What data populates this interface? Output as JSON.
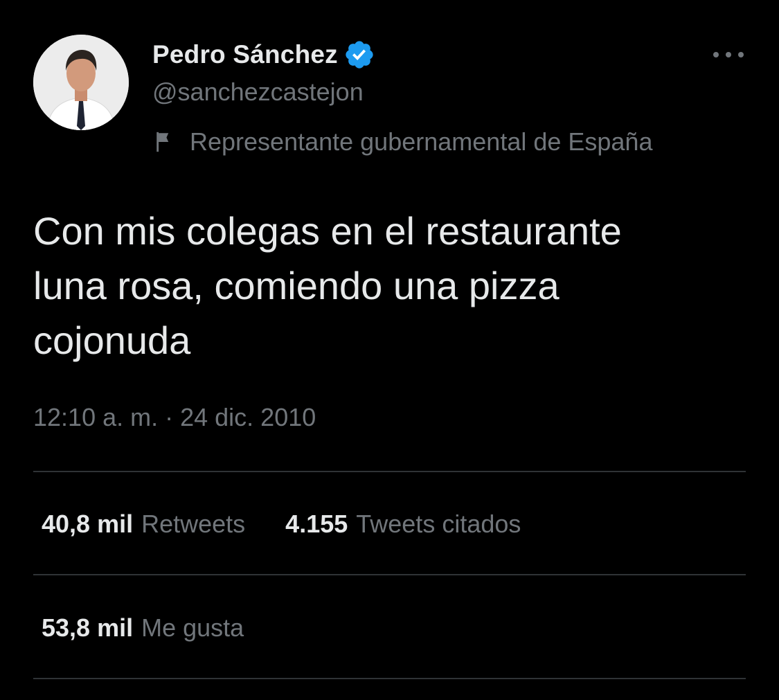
{
  "author": {
    "display_name": "Pedro Sánchez",
    "handle": "@sanchezcastejon",
    "verified_icon": "verified-badge-icon",
    "label": "Representante gubernamental de España",
    "label_icon": "flag-icon"
  },
  "tweet": {
    "text": "Con mis colegas en el restaurante\nluna rosa, comiendo una pizza\ncojonuda",
    "timestamp": "12:10 a. m. · 24 dic. 2010"
  },
  "stats": {
    "retweets_count": "40,8 mil",
    "retweets_label": "Retweets",
    "quotes_count": "4.155",
    "quotes_label": "Tweets citados",
    "likes_count": "53,8 mil",
    "likes_label": "Me gusta"
  },
  "colors": {
    "background": "#000000",
    "primary_text": "#e7e9ea",
    "secondary_text": "#71767b",
    "verified": "#1d9bf0",
    "divider": "#2f3336"
  }
}
